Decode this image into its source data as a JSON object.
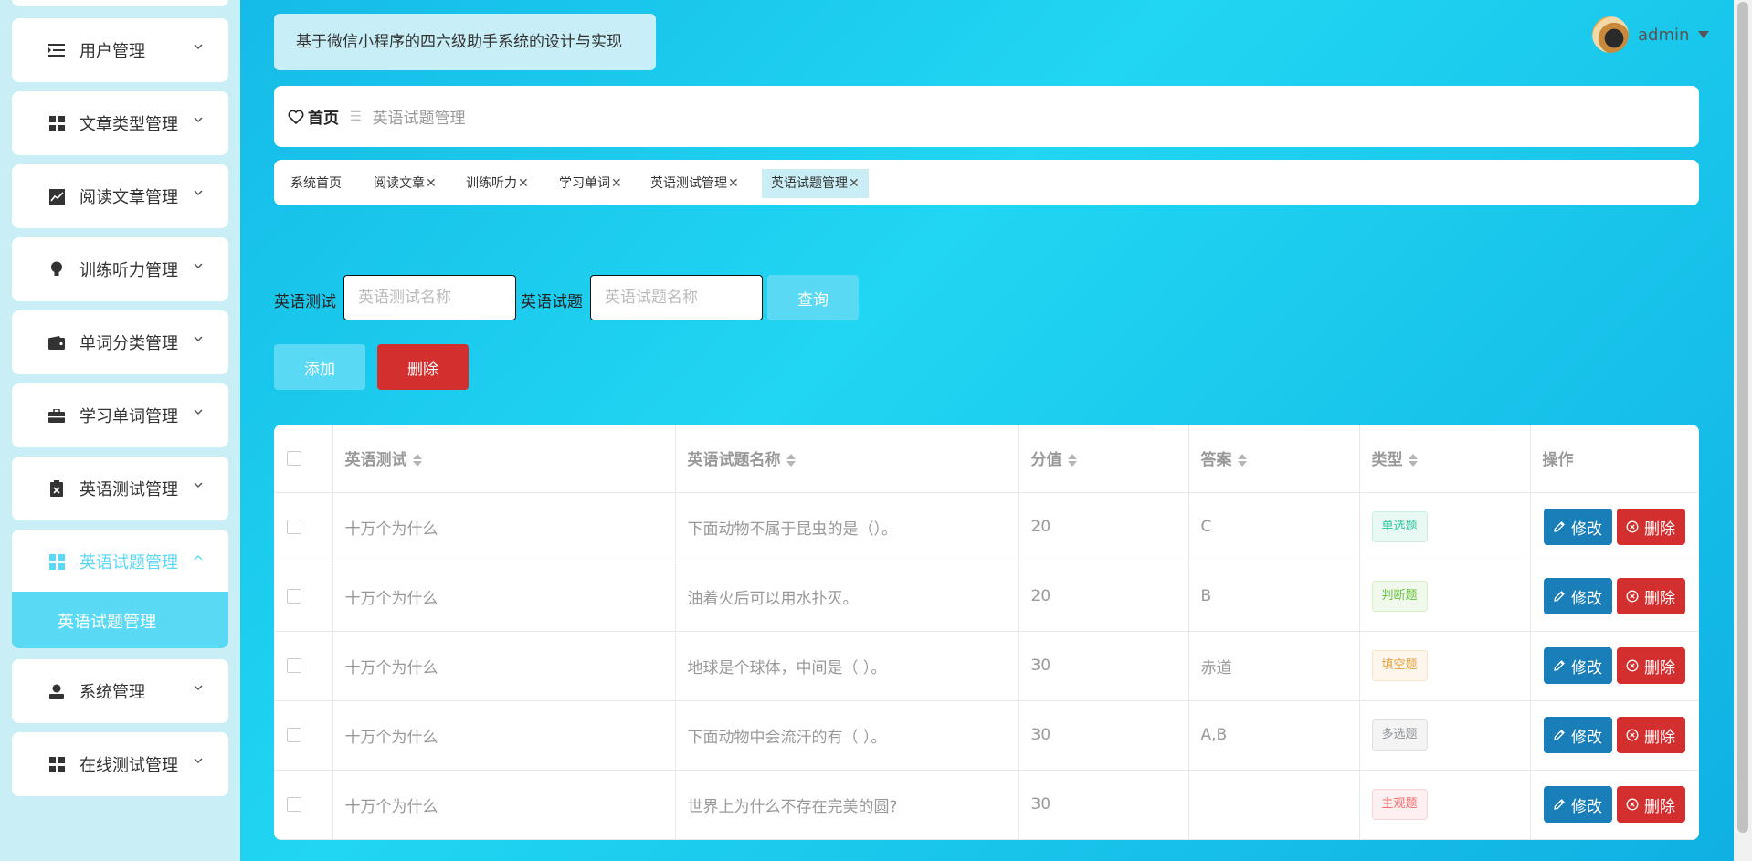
{
  "app": {
    "title": "基于微信小程序的四六级助手系统的设计与实现",
    "user": "admin"
  },
  "sidebar": {
    "items": [
      {
        "label": "用户管理",
        "icon": "list-indent-icon"
      },
      {
        "label": "文章类型管理",
        "icon": "grid-icon"
      },
      {
        "label": "阅读文章管理",
        "icon": "line-chart-icon"
      },
      {
        "label": "训练听力管理",
        "icon": "bulb-icon"
      },
      {
        "label": "单词分类管理",
        "icon": "wallet-icon"
      },
      {
        "label": "学习单词管理",
        "icon": "briefcase-icon"
      },
      {
        "label": "英语测试管理",
        "icon": "clipboard-x-icon"
      },
      {
        "label": "英语试题管理",
        "icon": "grid-icon"
      },
      {
        "label": "系统管理",
        "icon": "user-icon"
      },
      {
        "label": "在线测试管理",
        "icon": "grid-icon"
      }
    ],
    "submenu_label": "英语试题管理"
  },
  "breadcrumb": {
    "home": "首页",
    "current": "英语试题管理"
  },
  "tabs": [
    "系统首页",
    "阅读文章",
    "训练听力",
    "学习单词",
    "英语测试管理",
    "英语试题管理"
  ],
  "search": {
    "label1": "英语测试",
    "placeholder1": "英语测试名称",
    "label2": "英语试题",
    "placeholder2": "英语试题名称",
    "query": "查询"
  },
  "actions": {
    "add": "添加",
    "delete": "删除"
  },
  "table": {
    "headers": [
      "英语测试",
      "英语试题名称",
      "分值",
      "答案",
      "类型",
      "操作"
    ],
    "edit_label": "修改",
    "delete_label": "删除",
    "rows": [
      {
        "test": "十万个为什么",
        "name": "下面动物不属于昆虫的是（）。",
        "score": "20",
        "answer": "C",
        "type": "单选题"
      },
      {
        "test": "十万个为什么",
        "name": "油着火后可以用水扑灭。",
        "score": "20",
        "answer": "B",
        "type": "判断题"
      },
      {
        "test": "十万个为什么",
        "name": "地球是个球体，中间是（ ）。",
        "score": "30",
        "answer": "赤道",
        "type": "填空题"
      },
      {
        "test": "十万个为什么",
        "name": "下面动物中会流汗的有（ ）。",
        "score": "30",
        "answer": "A,B",
        "type": "多选题"
      },
      {
        "test": "十万个为什么",
        "name": "世界上为什么不存在完美的圆?",
        "score": "30",
        "answer": "",
        "type": "主观题"
      }
    ]
  }
}
